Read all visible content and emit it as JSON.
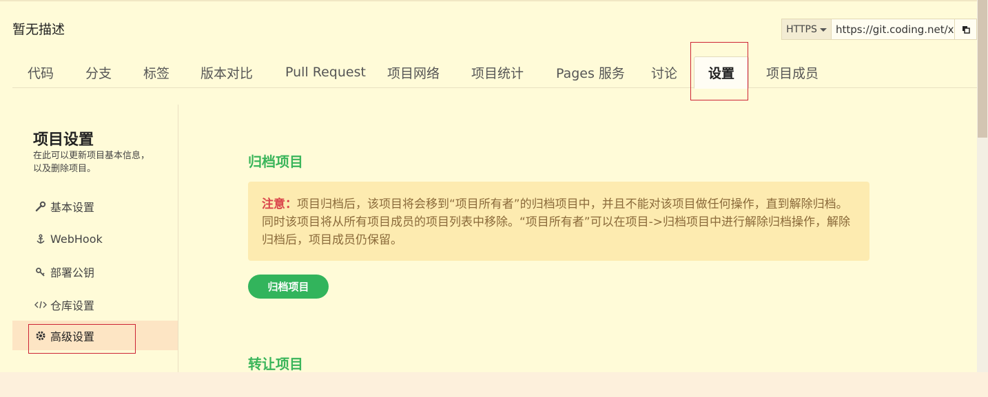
{
  "header": {
    "description": "暂无描述",
    "clone": {
      "protocol": "HTTPS",
      "url": "https://git.coding.net/xi"
    }
  },
  "tabs": [
    {
      "label": "代码"
    },
    {
      "label": "分支"
    },
    {
      "label": "标签"
    },
    {
      "label": "版本对比"
    },
    {
      "label": "Pull Request"
    },
    {
      "label": "项目网络"
    },
    {
      "label": "项目统计"
    },
    {
      "label": "Pages 服务"
    },
    {
      "label": "讨论"
    },
    {
      "label": "设置",
      "active": true
    },
    {
      "label": "项目成员"
    }
  ],
  "sidebar": {
    "title": "项目设置",
    "description": "在此可以更新项目基本信息，以及删除项目。",
    "items": [
      {
        "label": "基本设置",
        "icon": "wrench-icon"
      },
      {
        "label": "WebHook",
        "icon": "anchor-icon"
      },
      {
        "label": "部署公钥",
        "icon": "key-icon"
      },
      {
        "label": "仓库设置",
        "icon": "code-icon"
      },
      {
        "label": "高级设置",
        "icon": "gear-icon",
        "active": true
      }
    ]
  },
  "main": {
    "archive_section_title": "归档项目",
    "notice_label": "注意：",
    "notice_text": "项目归档后，该项目将会移到“项目所有者”的归档项目中，并且不能对该项目做任何操作，直到解除归档。同时该项目将从所有项目成员的项目列表中移除。“项目所有者”可以在项目->归档项目中进行解除归档操作，解除归档后，项目成员仍保留。",
    "archive_button": "归档项目",
    "transfer_section_title": "转让项目"
  },
  "colors": {
    "accent_green": "#32b45c",
    "warning_red": "#d9434a",
    "highlight_box": "#cc2233"
  }
}
